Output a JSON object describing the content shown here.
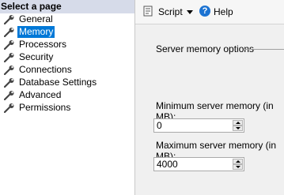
{
  "left_pane": {
    "header": "Select a page",
    "items": [
      {
        "label": "General",
        "icon": "wrench-icon"
      },
      {
        "label": "Memory",
        "icon": "wrench-icon",
        "selected": true
      },
      {
        "label": "Processors",
        "icon": "wrench-icon"
      },
      {
        "label": "Security",
        "icon": "wrench-icon"
      },
      {
        "label": "Connections",
        "icon": "wrench-icon"
      },
      {
        "label": "Database Settings",
        "icon": "wrench-icon"
      },
      {
        "label": "Advanced",
        "icon": "wrench-icon"
      },
      {
        "label": "Permissions",
        "icon": "wrench-icon"
      }
    ]
  },
  "toolbar": {
    "script_label": "Script",
    "help_label": "Help"
  },
  "memory": {
    "section_title": "Server memory options",
    "min_label": "Minimum server memory (in MB):",
    "min_value": "0",
    "max_label": "Maximum server memory (in MB):",
    "max_value": "4000"
  },
  "colors": {
    "selected_bg": "#0078d7",
    "header_bg": "#d6dbe9",
    "pane_bg": "#f0f0f0"
  }
}
